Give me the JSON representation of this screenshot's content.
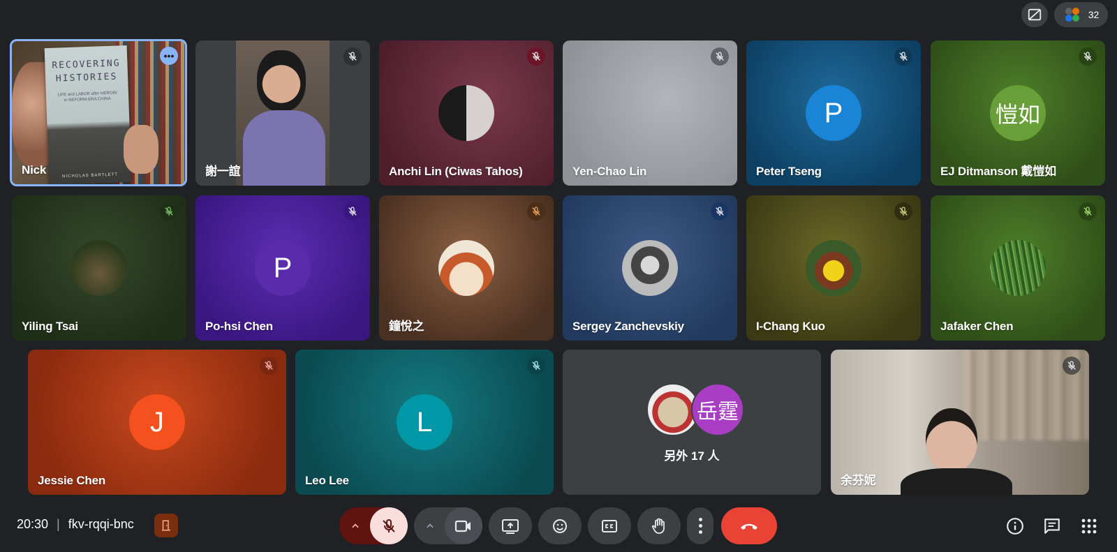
{
  "topbar": {
    "participant_count": "32"
  },
  "tiles": {
    "nick": "Nick",
    "xie": "謝一誼",
    "anchi": "Anchi Lin (Ciwas Tahos)",
    "yenchao": "Yen-Chao Lin",
    "peter": "Peter Tseng",
    "peter_initial": "P",
    "ej": "EJ Ditmanson 戴愷如",
    "ej_avatar": "愷如",
    "yiling": "Yiling Tsai",
    "pohsi": "Po-hsi Chen",
    "pohsi_initial": "P",
    "zhong": "鐘悅之",
    "sergey": "Sergey Zanchevskiy",
    "ichang": "I-Chang Kuo",
    "jafaker": "Jafaker Chen",
    "jessie": "Jessie Chen",
    "jessie_initial": "J",
    "leo": "Leo Lee",
    "leo_initial": "L",
    "others_avatar": "岳霆",
    "others_label": "另外 17 人",
    "yu": "余芬妮"
  },
  "book": {
    "title_line1": "RECOVERING",
    "title_line2": "HISTORIES",
    "subtitle": "LIFE and LABOR after HEROIN in REFORM-ERA CHINA",
    "author": "NICHOLAS BARTLETT"
  },
  "bottombar": {
    "time": "20:30",
    "separator": "|",
    "meeting_code": "fkv-rqqi-bnc"
  },
  "colors": {
    "background": "#202124",
    "leave": "#ea4335",
    "mic_off": "#f9dedc",
    "accent_border": "#8ab4f8"
  }
}
